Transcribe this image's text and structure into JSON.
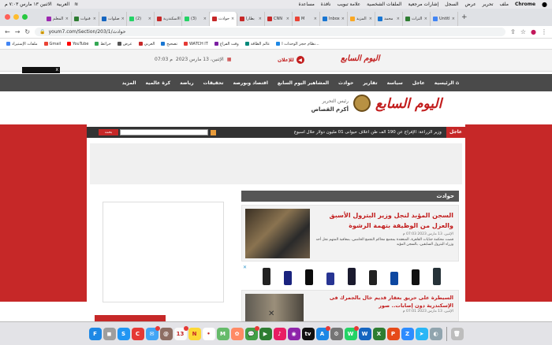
{
  "menubar": {
    "items": [
      "Chrome",
      "ملف",
      "تحرير",
      "عرض",
      "السجل",
      "إشارات مرجعية",
      "الملفات الشخصية",
      "علامة تبويب",
      "نافذة",
      "مساعدة"
    ],
    "status": [
      "العربية",
      "الاثنين ١٣ مارس ٧:٠٣ م"
    ]
  },
  "tabs": [
    {
      "label": "المعلم",
      "color": "#9c27b0"
    },
    {
      "label": "قنوات",
      "color": "#2e7d32"
    },
    {
      "label": "صلوات",
      "color": "#1565c0"
    },
    {
      "label": "(2)",
      "color": "#25d366"
    },
    {
      "label": "الاسكندرية",
      "color": "#c62828"
    },
    {
      "label": "(3)",
      "color": "#25d366"
    },
    {
      "label": "حوادث",
      "color": "#c62828"
    },
    {
      "label": "بطارا",
      "color": "#c62828"
    },
    {
      "label": "CNN",
      "color": "#c62828"
    },
    {
      "label": "M",
      "color": "#ea4335"
    },
    {
      "label": "Inbox",
      "color": "#1976d2"
    },
    {
      "label": "المزيد",
      "color": "#f9a825"
    },
    {
      "label": "محمد",
      "color": "#1976d2"
    },
    {
      "label": "التراث",
      "color": "#2e7d32"
    },
    {
      "label": "Untitl",
      "color": "#4285f4"
    }
  ],
  "addressbar": {
    "url": "youm7.com/Section/203/1/حوادث"
  },
  "bookmarks": [
    "ملفات الإستيراد",
    "Gmail",
    "YouTube",
    "خرائط",
    "عرض",
    "العربي",
    "تصحيح",
    "WATCH IT",
    "وقت الفراغ",
    "عالم الطاقة",
    "نظام حجز الوحدات ا..."
  ],
  "site": {
    "logo_small": "اليوم السابع",
    "advertise": "للإعلان",
    "date": "الإثنين، 13 مارس 2023",
    "time": "07:03 م",
    "nav": [
      "الرئيسية",
      "عاجل",
      "سياسة",
      "تقارير",
      "حوادث",
      "المشاهير اليوم السابع",
      "اقتصاد وبورصة",
      "تحقيقات",
      "رياضة",
      "كرة عالمية",
      "المزيد"
    ],
    "logo_big": "اليوم السابع",
    "editor_label": "رئيس التحرير",
    "editor_name": "أكرم القصاص",
    "ticker_label": "عاجل",
    "ticker_text": "وزير الزراعة: الإفراج عن 190 ألف طن أعلاف حيوانى 01 مليون دولار خلال أسبوع",
    "search_placeholder": "",
    "search_button": "بحث",
    "section_title": "حوادث",
    "article1": {
      "title": "السجن المؤبد لنجل وزير البترول الأسبق والعزل من الوظيفة بتهمة الرشوة",
      "meta": "الإثنين، 13 مارس 2023 07:03 م",
      "excerpt": "قضت محكمة جنايات القاهرة، المنعقدة بمجمع محاكم التجمع الخامس، بمعاقبة المتهم نجل أحد وزراء البترول السابقين، بالسجن المؤبد"
    },
    "article2": {
      "title": "السيطرة على حريق بعقار قديم خال بالجمرك فى الإسكندرية دون إصابات.. صور",
      "meta": "الإثنين، 13 مارس 2023 07:01 م"
    }
  },
  "dock": [
    {
      "name": "finder",
      "color": "#1e88e5",
      "t": "F"
    },
    {
      "name": "launchpad",
      "color": "#9e9e9e",
      "t": "◼"
    },
    {
      "name": "safari",
      "color": "#2196f3",
      "t": "S"
    },
    {
      "name": "chrome",
      "color": "#e53935",
      "t": "C"
    },
    {
      "name": "mail",
      "color": "#42a5f5",
      "t": "✉"
    },
    {
      "name": "contacts",
      "color": "#8d6e63",
      "t": "@"
    },
    {
      "name": "calendar",
      "color": "#fafafa",
      "t": "13"
    },
    {
      "name": "notes",
      "color": "#fdd835",
      "t": "N"
    },
    {
      "name": "reminders",
      "color": "#fff",
      "t": "•"
    },
    {
      "name": "maps",
      "color": "#66bb6a",
      "t": "M"
    },
    {
      "name": "photos",
      "color": "#ff8a65",
      "t": "✿"
    },
    {
      "name": "messages",
      "color": "#43a047",
      "t": "💬"
    },
    {
      "name": "facetime",
      "color": "#2e7d32",
      "t": "▶"
    },
    {
      "name": "music",
      "color": "#e91e63",
      "t": "♪"
    },
    {
      "name": "podcasts",
      "color": "#8e24aa",
      "t": "◉"
    },
    {
      "name": "tv",
      "color": "#111",
      "t": "tv"
    },
    {
      "name": "appstore",
      "color": "#1e88e5",
      "t": "A"
    },
    {
      "name": "settings",
      "color": "#757575",
      "t": "⚙"
    },
    {
      "name": "whatsapp",
      "color": "#25d366",
      "t": "W"
    },
    {
      "name": "word",
      "color": "#1565c0",
      "t": "W"
    },
    {
      "name": "excel",
      "color": "#2e7d32",
      "t": "X"
    },
    {
      "name": "powerpoint",
      "color": "#e64a19",
      "t": "P"
    },
    {
      "name": "zoom",
      "color": "#2d8cff",
      "t": "Z"
    },
    {
      "name": "telegram",
      "color": "#29b6f6",
      "t": "➤"
    },
    {
      "name": "preview",
      "color": "#90a4ae",
      "t": "◐"
    },
    {
      "name": "trash",
      "color": "#bdbdbd",
      "t": "🗑"
    }
  ],
  "colors": {
    "brand_red": "#c62828",
    "nav_gray": "#4a4a4a"
  }
}
